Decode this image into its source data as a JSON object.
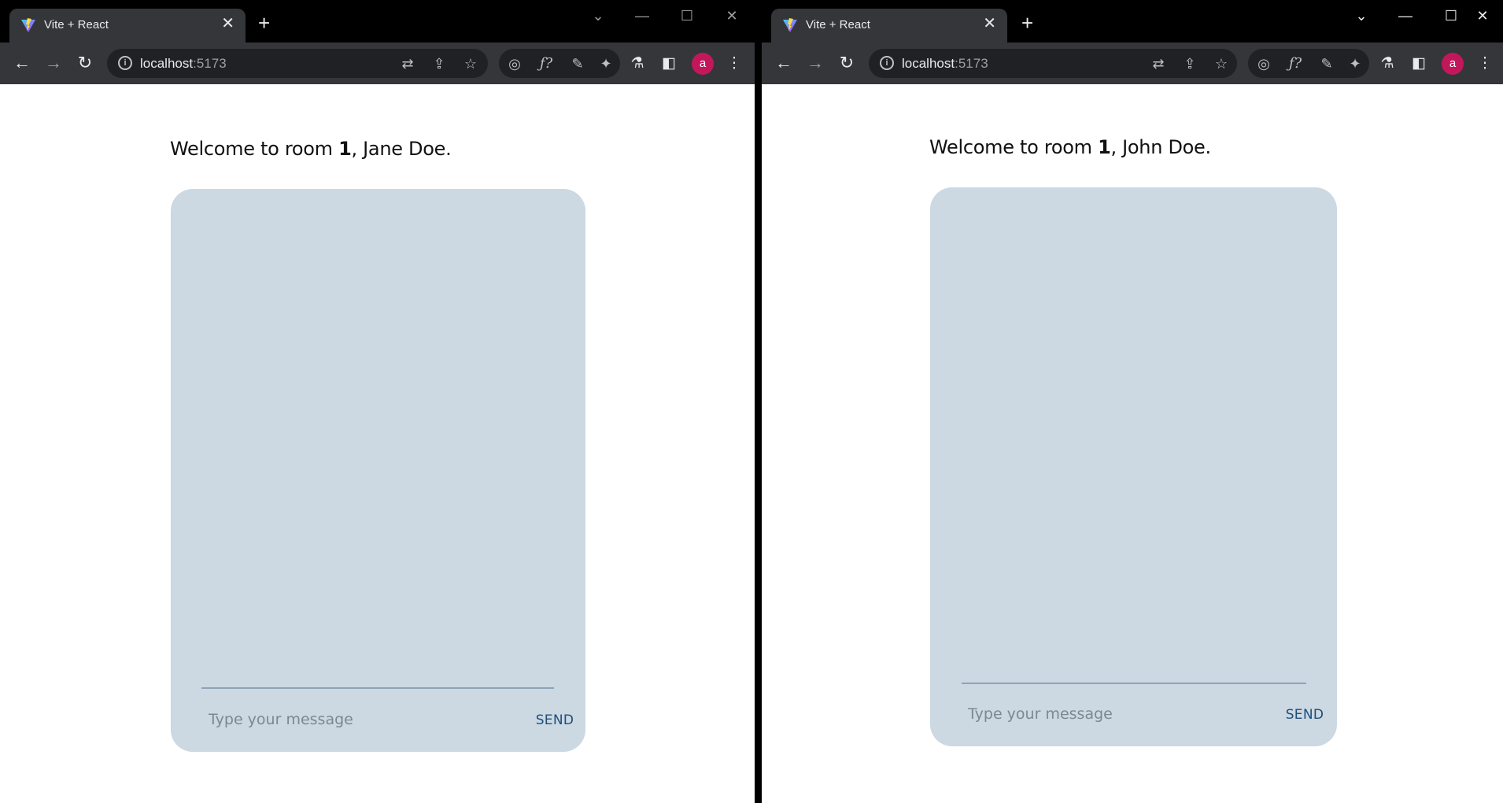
{
  "windows": [
    {
      "tab_title": "Vite + React",
      "url_host": "localhost",
      "url_port": ":5173",
      "avatar_letter": "a",
      "greeting_prefix": "Welcome to room ",
      "room": "1",
      "greeting_mid": ", ",
      "user_name": "Jane Doe",
      "greeting_suffix": ".",
      "message_placeholder": "Type your message",
      "send_label": "SEND"
    },
    {
      "tab_title": "Vite + React",
      "url_host": "localhost",
      "url_port": ":5173",
      "avatar_letter": "a",
      "greeting_prefix": "Welcome to room ",
      "room": "1",
      "greeting_mid": ", ",
      "user_name": "John Doe",
      "greeting_suffix": ".",
      "message_placeholder": "Type your message",
      "send_label": "SEND"
    }
  ],
  "colors": {
    "chat_background": "#ccd8e2",
    "send_text": "#1d4f7a",
    "avatar": "#c2185b",
    "chrome_dark": "#202124"
  },
  "icons": {
    "tab_favicon": "vite-logo-icon",
    "close": "close-icon",
    "new_tab": "plus-icon",
    "back": "arrow-left-icon",
    "forward": "arrow-right-icon",
    "reload": "reload-icon",
    "info": "info-icon",
    "translate": "translate-icon",
    "share": "share-icon",
    "bookmark": "star-icon",
    "extensions": "puzzle-icon",
    "labs": "flask-icon",
    "side_panel": "side-panel-icon",
    "menu": "kebab-menu-icon"
  }
}
